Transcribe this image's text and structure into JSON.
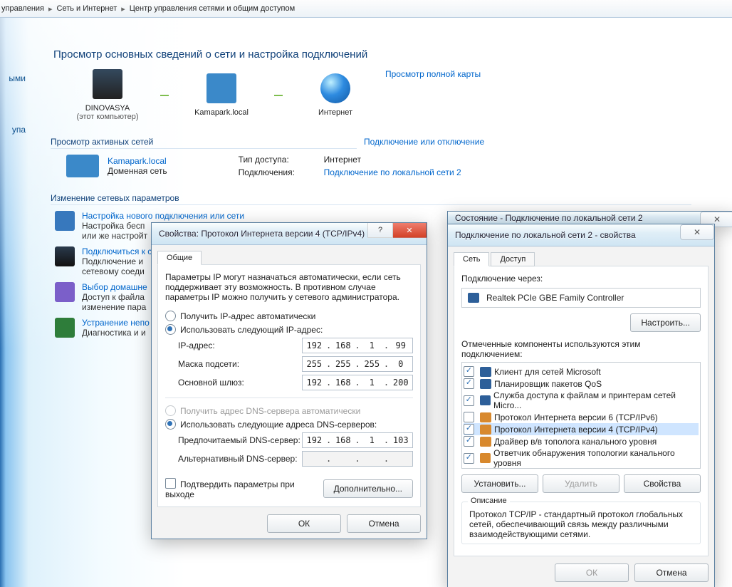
{
  "breadcrumbs": {
    "a": "управления",
    "b": "Сеть и Интернет",
    "c": "Центр управления сетями и общим доступом"
  },
  "sidebar_fragments": {
    "a": "ыми",
    "b": "упа"
  },
  "heading": "Просмотр основных сведений о сети и настройка подключений",
  "map": {
    "pc": "DINOVASYA",
    "pc_sub": "(этот компьютер)",
    "domain": "Kamapark.local",
    "inet": "Интернет",
    "full_map": "Просмотр полной карты"
  },
  "active": {
    "title": "Просмотр активных сетей",
    "link": "Подключение или отключение",
    "name": "Kamapark.local",
    "sub": "Доменная сеть",
    "k1": "Тип доступа:",
    "v1": "Интернет",
    "k2": "Подключения:",
    "v2": "Подключение по локальной сети 2"
  },
  "change": {
    "title": "Изменение сетевых параметров",
    "t1": "Настройка нового подключения или сети",
    "d1": "Настройка бесп",
    "d1b": "или же настройт",
    "t2": "Подключиться к се",
    "d2": "Подключение и",
    "d2b": "сетевому соеди",
    "t3": "Выбор домашне",
    "d3": "Доступ к файла",
    "d3b": "изменение пара",
    "t4": "Устранение непо",
    "d4": "Диагностика и и"
  },
  "behind": {
    "title": "Состояние - Подключение по локальной сети 2"
  },
  "ipv4": {
    "title": "Свойства: Протокол Интернета версии 4 (TCP/IPv4)",
    "tab": "Общие",
    "intro": "Параметры IP могут назначаться автоматически, если сеть поддерживает эту возможность. В противном случае параметры IP можно получить у сетевого администратора.",
    "r1": "Получить IP-адрес автоматически",
    "r2": "Использовать следующий IP-адрес:",
    "ip_l": "IP-адрес:",
    "ip": [
      "192",
      "168",
      "1",
      "99"
    ],
    "mask_l": "Маска подсети:",
    "mask": [
      "255",
      "255",
      "255",
      "0"
    ],
    "gw_l": "Основной шлюз:",
    "gw": [
      "192",
      "168",
      "1",
      "200"
    ],
    "r3": "Получить адрес DNS-сервера автоматически",
    "r4": "Использовать следующие адреса DNS-серверов:",
    "dns1_l": "Предпочитаемый DNS-сервер:",
    "dns1": [
      "192",
      "168",
      "1",
      "103"
    ],
    "dns2_l": "Альтернативный DNS-сервер:",
    "confirm": "Подтвердить параметры при выходе",
    "adv": "Дополнительно...",
    "ok": "ОК",
    "cancel": "Отмена"
  },
  "props": {
    "title": "Подключение по локальной сети 2 - свойства",
    "tab1": "Сеть",
    "tab2": "Доступ",
    "conn_via": "Подключение через:",
    "adapter": "Realtek PCIe GBE Family Controller",
    "configure": "Настроить...",
    "comp_label": "Отмеченные компоненты используются этим подключением:",
    "items": [
      {
        "chk": true,
        "ico": "ci-blue",
        "txt": "Клиент для сетей Microsoft"
      },
      {
        "chk": true,
        "ico": "ci-blue",
        "txt": "Планировщик пакетов QoS"
      },
      {
        "chk": true,
        "ico": "ci-blue",
        "txt": "Служба доступа к файлам и принтерам сетей Micro..."
      },
      {
        "chk": false,
        "ico": "ci-org",
        "txt": "Протокол Интернета версии 6 (TCP/IPv6)"
      },
      {
        "chk": true,
        "ico": "ci-org",
        "txt": "Протокол Интернета версии 4 (TCP/IPv4)"
      },
      {
        "chk": true,
        "ico": "ci-org",
        "txt": "Драйвер в/в тополога канального уровня"
      },
      {
        "chk": true,
        "ico": "ci-org",
        "txt": "Ответчик обнаружения топологии канального уровня"
      }
    ],
    "install": "Установить...",
    "remove": "Удалить",
    "btn_props": "Свойства",
    "desc_t": "Описание",
    "desc": "Протокол TCP/IP - стандартный протокол глобальных сетей, обеспечивающий связь между различными взаимодействующими сетями.",
    "ok": "ОК",
    "cancel": "Отмена"
  }
}
